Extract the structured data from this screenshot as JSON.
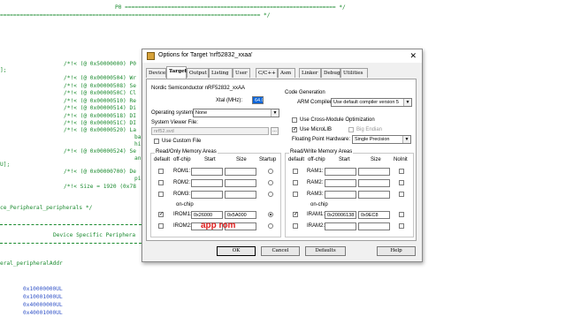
{
  "background_code": {
    "lines": [
      "P0 ================================================================ */",
      "=============================================================================== */",
      "/*!< (@ 0x50000000) P0",
      "];",
      "/*!< (@ 0x00000504) Wr",
      "/*!< (@ 0x00000508) Se",
      "/*!< (@ 0x0000050C) Cl",
      "/*!< (@ 0x00000510) Re",
      "/*!< (@ 0x00000514) Di",
      "/*!< (@ 0x00000518) DI",
      "/*!< (@ 0x0000051C) DI",
      "/*!< (@ 0x00000520) La",
      "ba",
      "hi",
      "/*!< (@ 0x00000524) Se",
      "an",
      "U];",
      "/*!< (@ 0x00000700) De",
      "pi",
      "/*!< Size = 1920 (0x78",
      "ce_Peripheral_peripherals */",
      "Device Specific Periphera",
      "eral_peripheralAddr",
      "0x10000000UL",
      "0x10001000UL",
      "0x40000000UL",
      "0x40001000UL"
    ]
  },
  "dialog": {
    "title": "Options for Target 'nrf52832_xxaa'",
    "close_glyph": "✕",
    "tabs": [
      "Device",
      "Target",
      "Output",
      "Listing",
      "User",
      "C/C++",
      "Asm",
      "Linker",
      "Debug",
      "Utilities"
    ],
    "active_tab_index": 1,
    "device_name": "Nordic Semiconductor nRF52832_xxAA",
    "xtal_label": "Xtal (MHz):",
    "xtal_value": "64.0",
    "os_label": "Operating system:",
    "os_value": "None",
    "svf_label": "System Viewer File:",
    "svf_value": "nrf52.svd",
    "custom_file_label": "Use Custom File",
    "code_gen_title": "Code Generation",
    "arm_compiler_label": "ARM Compiler:",
    "arm_compiler_value": "Use default compiler version 5",
    "cross_module_label": "Use Cross-Module Optimization",
    "microlib_label": "Use MicroLIB",
    "big_endian_label": "Big Endian",
    "fp_label": "Floating Point Hardware:",
    "fp_value": "Single Precision",
    "checks": {
      "custom_file": false,
      "cross_module": false,
      "microlib": true,
      "big_endian": false
    },
    "rom_group": {
      "title": "Read/Only Memory Areas",
      "headers": [
        "default",
        "off-chip",
        "Start",
        "Size",
        "Startup"
      ],
      "on_chip_label": "on-chip",
      "rows": [
        {
          "name": "ROM1:",
          "default": false,
          "start": "",
          "size": "",
          "startup": false
        },
        {
          "name": "ROM2:",
          "default": false,
          "start": "",
          "size": "",
          "startup": false
        },
        {
          "name": "ROM3:",
          "default": false,
          "start": "",
          "size": "",
          "startup": false
        },
        {
          "name": "IROM1:",
          "default": true,
          "start": "0x26000",
          "size": "0x5A000",
          "startup": true
        },
        {
          "name": "IROM2:",
          "default": false,
          "start": "",
          "size": "",
          "startup": false
        }
      ]
    },
    "ram_group": {
      "title": "Read/Write Memory Areas",
      "headers": [
        "default",
        "off-chip",
        "Start",
        "Size",
        "NoInit"
      ],
      "on_chip_label": "on-chip",
      "rows": [
        {
          "name": "RAM1:",
          "default": false,
          "start": "",
          "size": "",
          "noinit": false
        },
        {
          "name": "RAM2:",
          "default": false,
          "start": "",
          "size": "",
          "noinit": false
        },
        {
          "name": "RAM3:",
          "default": false,
          "start": "",
          "size": "",
          "noinit": false
        },
        {
          "name": "IRAM1:",
          "default": true,
          "start": "0x20006138",
          "size": "0x9EC8",
          "noinit": false
        },
        {
          "name": "IRAM2:",
          "default": false,
          "start": "",
          "size": "",
          "noinit": false
        }
      ]
    },
    "buttons": {
      "ok": "OK",
      "cancel": "Cancel",
      "defaults": "Defaults",
      "help": "Help"
    }
  },
  "annotation": {
    "text": "app rom",
    "color": "#e02020"
  }
}
